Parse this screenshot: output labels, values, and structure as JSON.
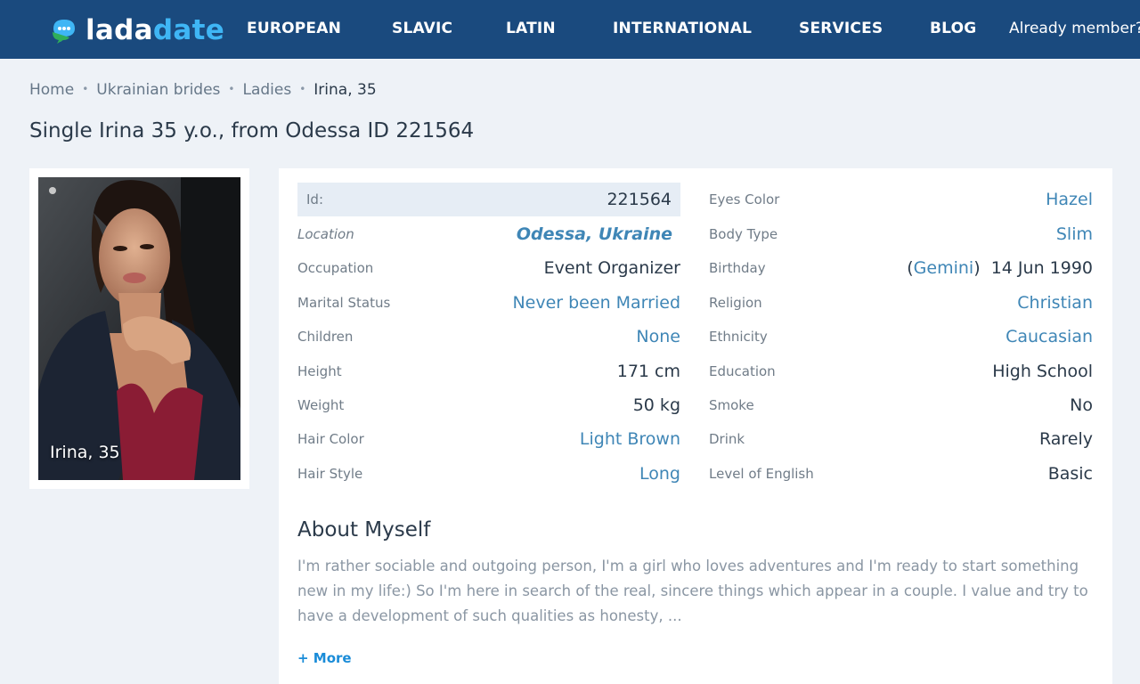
{
  "header": {
    "logo_part1": "lada",
    "logo_part2": "date",
    "nav": [
      "EUROPEAN",
      "SLAVIC",
      "LATIN",
      "INTERNATIONAL",
      "SERVICES",
      "BLOG"
    ],
    "member_link": "Already member?"
  },
  "breadcrumb": [
    "Home",
    "Ukrainian brides",
    "Ladies",
    "Irina, 35"
  ],
  "page_title": "Single Irina 35 y.o., from Odessa ID 221564",
  "photo": {
    "caption": "Irina, 35"
  },
  "profile": {
    "left": [
      {
        "label": "Id:",
        "value": "221564"
      },
      {
        "label": "Location",
        "value": "Odessa, Ukraine"
      },
      {
        "label": "Occupation",
        "value": "Event Organizer"
      },
      {
        "label": "Marital Status",
        "value": "Never been Married"
      },
      {
        "label": "Children",
        "value": "None"
      },
      {
        "label": "Height",
        "value": "171 cm"
      },
      {
        "label": "Weight",
        "value": "50 kg"
      },
      {
        "label": "Hair Color",
        "value": "Light Brown"
      },
      {
        "label": "Hair Style",
        "value": "Long"
      }
    ],
    "right": [
      {
        "label": "Eyes Color",
        "value": "Hazel"
      },
      {
        "label": "Body Type",
        "value": "Slim"
      },
      {
        "label": "Birthday",
        "value": "14 Jun 1990",
        "zodiac": "Gemini"
      },
      {
        "label": "Religion",
        "value": "Christian"
      },
      {
        "label": "Ethnicity",
        "value": "Caucasian"
      },
      {
        "label": "Education",
        "value": "High School"
      },
      {
        "label": "Smoke",
        "value": "No"
      },
      {
        "label": "Drink",
        "value": "Rarely"
      },
      {
        "label": "Level of English",
        "value": "Basic"
      }
    ]
  },
  "about": {
    "title": "About Myself",
    "text": "I'm rather sociable and outgoing person, I'm a girl who loves adventures and I'm ready to start something new in my life:) So I'm here in search of the real, sincere things which appear in a couple. I value and try to have a development of such qualities as honesty, ...",
    "more": "+ More"
  },
  "colors": {
    "header_bg": "#1a4a7e",
    "accent_blue": "#3fb6f5",
    "link": "#3f86b6",
    "more_link": "#1a8cd8",
    "page_bg": "#eef2f7"
  }
}
